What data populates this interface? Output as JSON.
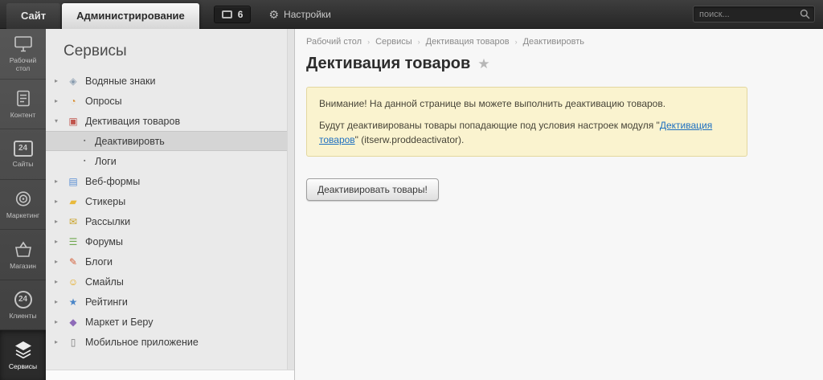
{
  "icons": {
    "gear": "⚙",
    "chevron_right": "▸",
    "chevron_down": "▾",
    "bullet": "▪",
    "star": "★",
    "crumb_sep": "›"
  },
  "topbar": {
    "tabs": [
      {
        "label": "Сайт"
      },
      {
        "label": "Администрирование"
      }
    ],
    "notifications_count": "6",
    "settings_label": "Настройки",
    "search_placeholder": "поиск..."
  },
  "rail": {
    "items": [
      {
        "label": "Рабочий стол"
      },
      {
        "label": "Контент"
      },
      {
        "label": "Сайты",
        "badge": "24"
      },
      {
        "label": "Маркетинг"
      },
      {
        "label": "Магазин"
      },
      {
        "label": "Клиенты",
        "badge": "24"
      },
      {
        "label": "Сервисы"
      }
    ]
  },
  "menu": {
    "title": "Сервисы",
    "items": [
      {
        "label": "Водяные знаки",
        "glyph": "◈"
      },
      {
        "label": "Опросы",
        "glyph": "◔"
      },
      {
        "label": "Дективация товаров",
        "glyph": "▣"
      },
      {
        "label": "Деактивировть"
      },
      {
        "label": "Логи"
      },
      {
        "label": "Веб-формы",
        "glyph": "▤"
      },
      {
        "label": "Стикеры",
        "glyph": "▰"
      },
      {
        "label": "Рассылки",
        "glyph": "✉"
      },
      {
        "label": "Форумы",
        "glyph": "☰"
      },
      {
        "label": "Блоги",
        "glyph": "✎"
      },
      {
        "label": "Смайлы",
        "glyph": "☺"
      },
      {
        "label": "Рейтинги",
        "glyph": "★"
      },
      {
        "label": "Маркет и Беру",
        "glyph": "◆"
      },
      {
        "label": "Мобильное приложение",
        "glyph": "▯"
      }
    ]
  },
  "main": {
    "breadcrumb": [
      "Рабочий стол",
      "Сервисы",
      "Дективация товаров",
      "Деактивировть"
    ],
    "page_title": "Дективация товаров",
    "warning": {
      "line1": "Внимание! На данной странице вы можете выполнить деактивацию товаров.",
      "line2_prefix": "Будут деактивированы товары попадающие под условия настроек модуля \"",
      "line2_link": "Дективация товаров",
      "line2_suffix": "\" (itserw.proddeactivator)."
    },
    "button_label": "Деактивировать товары!"
  }
}
